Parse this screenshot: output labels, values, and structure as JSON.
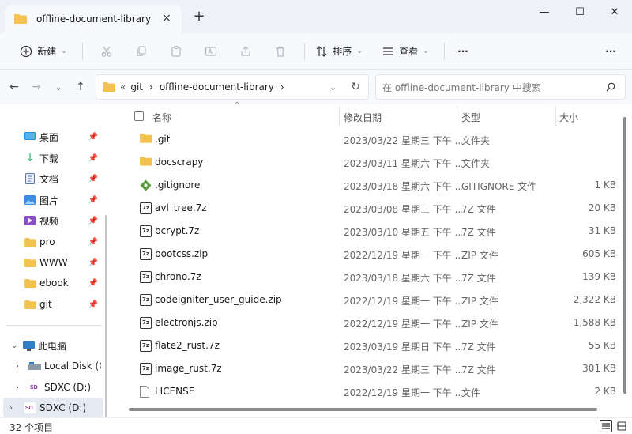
{
  "tab": {
    "title": "offline-document-library",
    "close_icon": "×",
    "new_icon": "+"
  },
  "window_controls": {
    "minimize": "—",
    "maximize": "☐",
    "close": "✕"
  },
  "toolbar": {
    "new_label": "新建",
    "sort_label": "排序",
    "view_label": "查看",
    "more": "···"
  },
  "address": {
    "overflow": "«",
    "crumbs": [
      "git",
      "offline-document-library"
    ]
  },
  "search": {
    "placeholder": "在 offline-document-library 中搜索"
  },
  "sidebar": {
    "quick_access": [
      {
        "label": "桌面",
        "icon": "desktop-icon"
      },
      {
        "label": "下载",
        "icon": "download-icon"
      },
      {
        "label": "文档",
        "icon": "documents-icon"
      },
      {
        "label": "图片",
        "icon": "pictures-icon"
      },
      {
        "label": "视频",
        "icon": "videos-icon"
      },
      {
        "label": "pro",
        "icon": "folder-icon"
      },
      {
        "label": "WWW",
        "icon": "folder-icon"
      },
      {
        "label": "ebook",
        "icon": "folder-icon"
      },
      {
        "label": "git",
        "icon": "folder-icon"
      }
    ],
    "this_pc": "此电脑",
    "drives": [
      "Local Disk (C:)",
      "SDXC (D:)"
    ],
    "selected_drive": "SDXC (D:)"
  },
  "columns": {
    "name": "名称",
    "date": "修改日期",
    "type": "类型",
    "size": "大小"
  },
  "files": [
    {
      "name": ".git",
      "date": "2023/03/22 星期三 下午 ...",
      "type": "文件夹",
      "size": "",
      "icon": "folder-icon"
    },
    {
      "name": "docscrapy",
      "date": "2023/03/11 星期六 下午 ...",
      "type": "文件夹",
      "size": "",
      "icon": "folder-icon"
    },
    {
      "name": ".gitignore",
      "date": "2023/03/18 星期六 下午 ...",
      "type": "GITIGNORE 文件",
      "size": "1 KB",
      "icon": "gitignore-icon"
    },
    {
      "name": "avl_tree.7z",
      "date": "2023/03/08 星期三 下午 ...",
      "type": "7Z 文件",
      "size": "20 KB",
      "icon": "archive-icon"
    },
    {
      "name": "bcrypt.7z",
      "date": "2023/03/10 星期五 下午 ...",
      "type": "7Z 文件",
      "size": "31 KB",
      "icon": "archive-icon"
    },
    {
      "name": "bootcss.zip",
      "date": "2022/12/19 星期一 下午 ...",
      "type": "ZIP 文件",
      "size": "605 KB",
      "icon": "archive-icon"
    },
    {
      "name": "chrono.7z",
      "date": "2023/03/18 星期六 下午 ...",
      "type": "7Z 文件",
      "size": "139 KB",
      "icon": "archive-icon"
    },
    {
      "name": "codeigniter_user_guide.zip",
      "date": "2022/12/19 星期一 下午 ...",
      "type": "ZIP 文件",
      "size": "2,322 KB",
      "icon": "archive-icon"
    },
    {
      "name": "electronjs.zip",
      "date": "2022/12/19 星期一 下午 ...",
      "type": "ZIP 文件",
      "size": "1,588 KB",
      "icon": "archive-icon"
    },
    {
      "name": "flate2_rust.7z",
      "date": "2023/03/19 星期日 下午 ...",
      "type": "7Z 文件",
      "size": "55 KB",
      "icon": "archive-icon"
    },
    {
      "name": "image_rust.7z",
      "date": "2023/03/22 星期三 下午 ...",
      "type": "7Z 文件",
      "size": "301 KB",
      "icon": "archive-icon"
    },
    {
      "name": "LICENSE",
      "date": "2022/12/19 星期一 下午 ...",
      "type": "文件",
      "size": "2 KB",
      "icon": "file-icon"
    }
  ],
  "status": {
    "count": "32 个项目"
  },
  "colors": {
    "accent": "#0067c0",
    "folder": "#f2c14e",
    "chrome": "#eef1f8"
  }
}
